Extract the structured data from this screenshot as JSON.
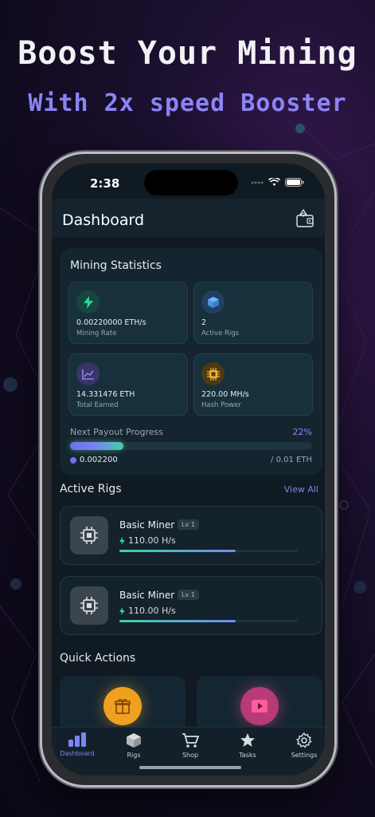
{
  "promo": {
    "headline": "Boost Your Mining",
    "subheadline": "With 2x speed Booster"
  },
  "status_bar": {
    "time": "2:38"
  },
  "header": {
    "title": "Dashboard",
    "wallet_icon": "wallet-icon"
  },
  "mining_stats": {
    "title": "Mining Statistics",
    "items": [
      {
        "value": "0.00220000 ETH/s",
        "label": "Mining Rate",
        "icon": "bolt-icon",
        "color": "#2fd3a0"
      },
      {
        "value": "2",
        "label": "Active Rigs",
        "icon": "cube-icon",
        "color": "#4aa3f0"
      },
      {
        "value": "14.331476 ETH",
        "label": "Total Earned",
        "icon": "trend-icon",
        "color": "#8b84f5"
      },
      {
        "value": "220.00 MH/s",
        "label": "Hash Power",
        "icon": "chip-icon",
        "color": "#f0b429"
      }
    ],
    "payout": {
      "label": "Next Payout Progress",
      "percent_text": "22%",
      "progress": 0.22,
      "current": "0.002200",
      "target": "/ 0.01 ETH"
    }
  },
  "active_rigs": {
    "title": "Active Rigs",
    "view_all": "View All",
    "rigs": [
      {
        "name": "Basic Miner",
        "level": "Lv 1",
        "rate": "110.00 H/s",
        "progress": 0.65
      },
      {
        "name": "Basic Miner",
        "level": "Lv 1",
        "rate": "110.00 H/s",
        "progress": 0.65
      }
    ]
  },
  "quick_actions": {
    "title": "Quick Actions",
    "items": [
      {
        "icon": "gift-icon",
        "color": "#f0a020"
      },
      {
        "icon": "video-play-icon",
        "color": "#e8508a"
      }
    ]
  },
  "tabs": [
    {
      "label": "Dashboard",
      "icon": "bar-chart-icon",
      "active": true
    },
    {
      "label": "Rigs",
      "icon": "box-icon",
      "active": false
    },
    {
      "label": "Shop",
      "icon": "cart-icon",
      "active": false
    },
    {
      "label": "Tasks",
      "icon": "star-icon",
      "active": false
    },
    {
      "label": "Settings",
      "icon": "gear-icon",
      "active": false
    }
  ]
}
